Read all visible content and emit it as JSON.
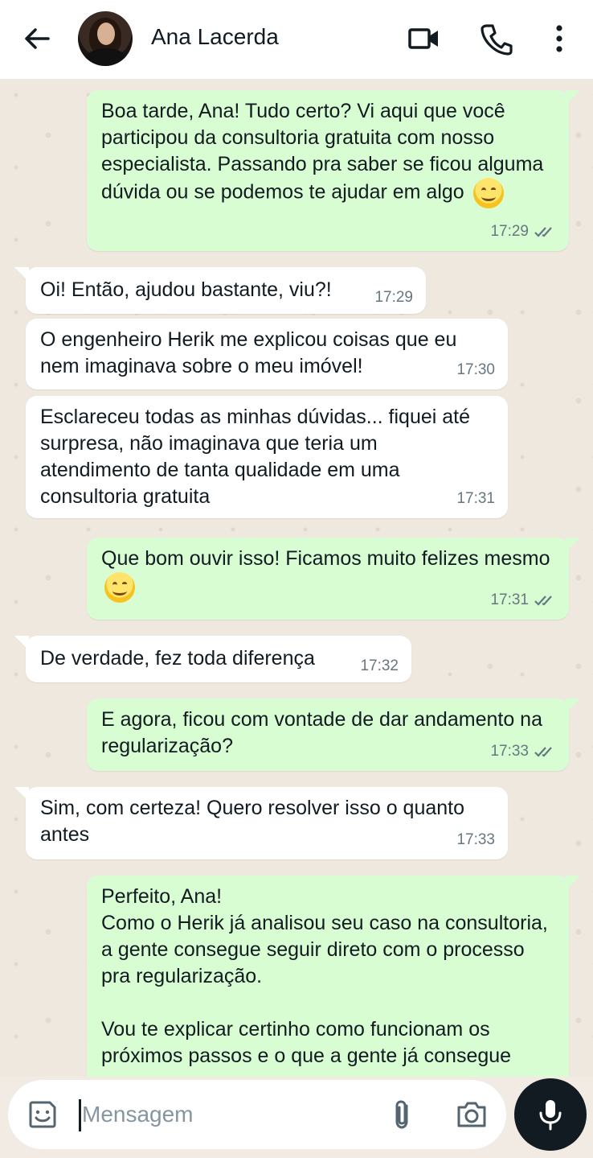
{
  "header": {
    "contact_name": "Ana Lacerda",
    "icons": [
      "back-arrow-icon",
      "video-call-icon",
      "voice-call-icon",
      "more-options-icon"
    ]
  },
  "messages": [
    {
      "dir": "out",
      "text": "Boa tarde, Ana! Tudo certo? Vi aqui que você participou da consultoria gratuita com nosso especialista. Passando pra saber se ficou alguma dúvida ou se podemos te ajudar em algo",
      "emoji": "smiling-face",
      "time": "17:29",
      "status": "read"
    },
    {
      "dir": "in",
      "text": "Oi! Então, ajudou bastante, viu?!",
      "time": "17:29"
    },
    {
      "dir": "in",
      "text": "O engenheiro Herik me explicou coisas que eu nem imaginava sobre o meu imóvel!",
      "time": "17:30"
    },
    {
      "dir": "in",
      "text": "Esclareceu todas as minhas dúvidas... fiquei até surpresa, não imaginava que teria um atendimento de tanta qualidade em uma consultoria gratuita",
      "time": "17:31"
    },
    {
      "dir": "out",
      "text": "Que bom ouvir isso! Ficamos muito felizes mesmo",
      "emoji": "smiling-face",
      "time": "17:31",
      "status": "read"
    },
    {
      "dir": "in",
      "text": "De verdade, fez toda diferença",
      "time": "17:32"
    },
    {
      "dir": "out",
      "text": "E agora, ficou com vontade de dar andamento na regularização?",
      "time": "17:33",
      "status": "read"
    },
    {
      "dir": "in",
      "text": "Sim, com certeza! Quero resolver isso o quanto antes",
      "time": "17:33"
    },
    {
      "dir": "out",
      "text": "Perfeito, Ana!\nComo o Herik já analisou seu caso na consultoria, a gente consegue seguir direto com o processo pra regularização.\n\nVou te explicar certinho como funcionam os próximos passos e o que a gente já consegue",
      "time": "",
      "status": ""
    }
  ],
  "composer": {
    "placeholder": "Mensagem",
    "icons": [
      "sticker-icon",
      "attach-icon",
      "camera-icon",
      "microphone-icon"
    ]
  },
  "colors": {
    "outgoing_bubble": "#d9fdd3",
    "incoming_bubble": "#ffffff",
    "chat_background": "#efe8df",
    "read_ticks": "#667781"
  }
}
